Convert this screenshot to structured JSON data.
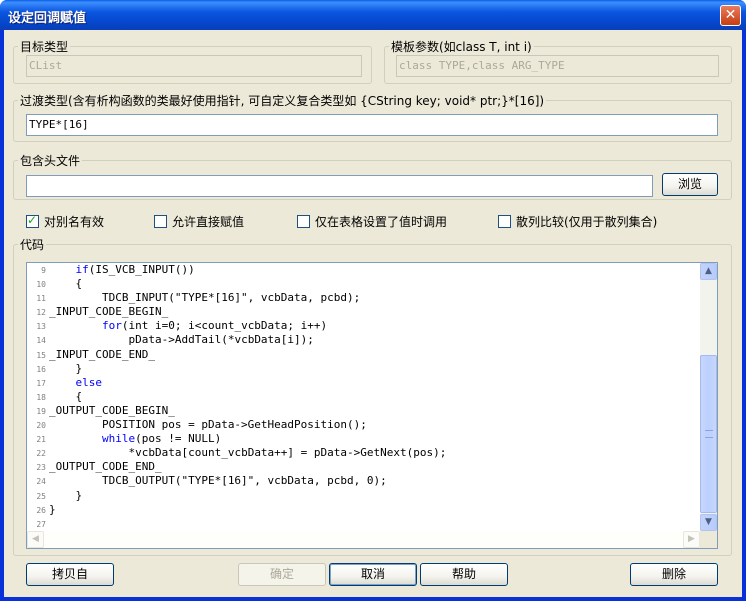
{
  "window": {
    "title": "设定回调赋值",
    "close_glyph": "✕"
  },
  "target_type": {
    "legend": "目标类型",
    "value": "CList"
  },
  "template_params": {
    "legend": "模板参数(如class T, int i)",
    "value": "class TYPE,class ARG_TYPE"
  },
  "transition_type": {
    "legend": "过渡类型(含有析构函数的类最好使用指针, 可自定义复合类型如 {CString key; void* ptr;}*[16])",
    "value": "TYPE*[16]"
  },
  "include_header": {
    "legend": "包含头文件",
    "value": "",
    "browse_label": "浏览"
  },
  "checkboxes": [
    {
      "label": "对别名有效",
      "checked": true
    },
    {
      "label": "允许直接赋值",
      "checked": false
    },
    {
      "label": "仅在表格设置了值时调用",
      "checked": false
    },
    {
      "label": "散列比较(仅用于散列集合)",
      "checked": false
    }
  ],
  "code": {
    "legend": "代码",
    "lines": [
      {
        "num": "9",
        "pre": "    ",
        "kw": "if",
        "text": "(IS_VCB_INPUT())"
      },
      {
        "num": "10",
        "pre": "    ",
        "kw": "",
        "text": "{"
      },
      {
        "num": "11",
        "pre": "        ",
        "kw": "",
        "text": "TDCB_INPUT(\"TYPE*[16]\", vcbData, pcbd);"
      },
      {
        "num": "12",
        "pre": "",
        "kw": "",
        "text": "_INPUT_CODE_BEGIN_"
      },
      {
        "num": "13",
        "pre": "        ",
        "kw": "for",
        "text": "(int i=0; i<count_vcbData; i++)"
      },
      {
        "num": "14",
        "pre": "            ",
        "kw": "",
        "text": "pData->AddTail(*vcbData[i]);"
      },
      {
        "num": "15",
        "pre": "",
        "kw": "",
        "text": "_INPUT_CODE_END_"
      },
      {
        "num": "16",
        "pre": "    ",
        "kw": "",
        "text": "}"
      },
      {
        "num": "17",
        "pre": "    ",
        "kw": "else",
        "text": ""
      },
      {
        "num": "18",
        "pre": "    ",
        "kw": "",
        "text": "{"
      },
      {
        "num": "19",
        "pre": "",
        "kw": "",
        "text": "_OUTPUT_CODE_BEGIN_"
      },
      {
        "num": "20",
        "pre": "        ",
        "kw": "",
        "text": "POSITION pos = pData->GetHeadPosition();"
      },
      {
        "num": "21",
        "pre": "        ",
        "kw": "while",
        "text": "(pos != NULL)"
      },
      {
        "num": "22",
        "pre": "            ",
        "kw": "",
        "text": "*vcbData[count_vcbData++] = pData->GetNext(pos);"
      },
      {
        "num": "23",
        "pre": "",
        "kw": "",
        "text": "_OUTPUT_CODE_END_"
      },
      {
        "num": "24",
        "pre": "        ",
        "kw": "",
        "text": "TDCB_OUTPUT(\"TYPE*[16]\", vcbData, pcbd, 0);"
      },
      {
        "num": "25",
        "pre": "    ",
        "kw": "",
        "text": "}"
      },
      {
        "num": "26",
        "pre": "",
        "kw": "",
        "text": "}"
      },
      {
        "num": "27",
        "pre": "",
        "kw": "",
        "text": ""
      }
    ]
  },
  "buttons": {
    "copy_from": "拷贝自",
    "ok": "确定",
    "cancel": "取消",
    "help": "帮助",
    "delete": "删除"
  },
  "colors": {
    "keyword": "#0000ff",
    "title_bar": "#0a55e0",
    "dialog_bg": "#ece9d8"
  }
}
